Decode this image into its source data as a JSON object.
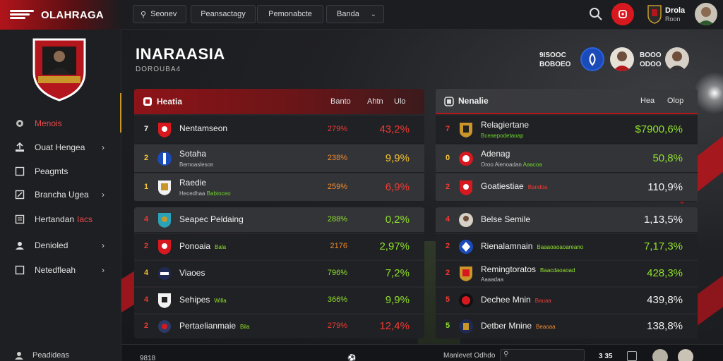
{
  "brand": {
    "title": "OLAHRAGA"
  },
  "topnav": {
    "search_label": "Seonev",
    "btn2": "Peansactagy",
    "btn3": "Pemonabcte",
    "dropdown": "Banda"
  },
  "user": {
    "name": "Drola",
    "sub": "Roon"
  },
  "sidebar": {
    "items": [
      {
        "label": "Menois",
        "icon": "home-icon",
        "active": true
      },
      {
        "label": "Ouat Hengea",
        "icon": "upload-icon",
        "chevron": true
      },
      {
        "label": "Peagmts",
        "icon": "square-icon"
      },
      {
        "label": "Brancha Ugea",
        "icon": "edit-icon",
        "chevron": true
      },
      {
        "label": "Hertandan",
        "accent": "Iacs",
        "icon": "document-icon"
      },
      {
        "label": "Denioled",
        "icon": "user-icon",
        "chevron": true
      },
      {
        "label": "Netedfleah",
        "icon": "square-icon",
        "chevron": true
      }
    ],
    "bottom": "Peadideas"
  },
  "page": {
    "title": "INARAASIA",
    "subtitle": "DOROUBA4"
  },
  "match": {
    "left_top": "9ISOOC",
    "left_bottom": "BOBOEO",
    "right_top": "BOOO",
    "right_bottom": "ODOO"
  },
  "left_panel": {
    "title": "Heatia",
    "col1": "Banto",
    "col2": "Ahtn",
    "col3": "Ulo",
    "rows": [
      {
        "rank": "7",
        "name": "Nentamseon",
        "pct": "279%",
        "val": "43,2%"
      },
      {
        "rank": "2",
        "name": "Sotaha",
        "sub": "Bemoasleson",
        "pct": "238%",
        "val": "9,9%"
      },
      {
        "rank": "1",
        "name": "Raedie",
        "sub": "Hecedhaa",
        "sub2": "Babtoceo",
        "pct": "259%",
        "val": "6,9%"
      }
    ]
  },
  "left_panel2": {
    "rows": [
      {
        "rank": "4",
        "name": "Seapec Peldaing",
        "pct": "288%",
        "val": "0,2%"
      },
      {
        "rank": "2",
        "name": "Ponoaia",
        "tag": "Bala",
        "pct": "2176",
        "val": "2,97%"
      },
      {
        "rank": "4",
        "name": "Viaoes",
        "pct": "796%",
        "val": "7,2%"
      },
      {
        "rank": "4",
        "name": "Sehipes",
        "tag": "Willa",
        "pct": "366%",
        "val": "9,9%"
      },
      {
        "rank": "2",
        "name": "Pertaelianmaie",
        "tag": "Bila",
        "pct": "279%",
        "val": "12,4%"
      }
    ]
  },
  "right_panel": {
    "title": "Nenalie",
    "col1": "Hea",
    "col2": "Olop",
    "rows": [
      {
        "rank": "7",
        "name": "Relagiertane",
        "sub": "Bceaepodetaoap",
        "val": "$7900,6%"
      },
      {
        "rank": "0",
        "name": "Adenag",
        "sub": "Oroo Aienoadan",
        "sub2": "Aaacoa",
        "val": "50,8%"
      },
      {
        "rank": "2",
        "name": "Goatiestiae",
        "tag": "Bandoa",
        "val": "110,9%"
      }
    ]
  },
  "right_panel2": {
    "rows": [
      {
        "rank": "4",
        "name": "Belse Semile",
        "val": "1,13,5%"
      },
      {
        "rank": "2",
        "name": "Rienalamnain",
        "tag": "Baaaoaoaoareano",
        "val": "7,17,3%"
      },
      {
        "rank": "2",
        "name": "Remingtoratos",
        "tag": "Baacdaoaoad",
        "sub": "Aaaadaa",
        "val": "428,3%"
      },
      {
        "rank": "5",
        "name": "Dechee Mnin",
        "tag": "Bauaa",
        "val": "439,8%"
      },
      {
        "rank": "5",
        "name": "Detber Mnine",
        "tag": "Beaoaa",
        "val": "138,8%"
      }
    ]
  },
  "footer": {
    "left": "9818",
    "label": "Manlevet Odhdo",
    "score": "3 35"
  },
  "colors": {
    "accent": "#d7191f",
    "positive": "#8fe02c",
    "negative": "#ee3b33"
  }
}
